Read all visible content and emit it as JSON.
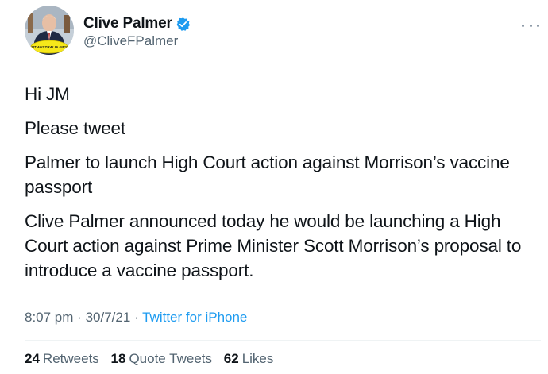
{
  "author": {
    "display_name": "Clive Palmer",
    "handle": "@CliveFPalmer",
    "avatar_badge_text": "PUT AUSTRALIA FIRST",
    "verified_icon": "verified-badge-icon"
  },
  "tweet": {
    "paragraphs": [
      "Hi JM",
      "Please tweet",
      "Palmer to launch High Court action against Morrison’s vaccine passport",
      "Clive Palmer announced today he would be launching a High Court action against Prime Minister Scott Morrison’s proposal to introduce a vaccine passport."
    ],
    "time": "8:07 pm",
    "date": "30/7/21",
    "separator": "·",
    "source": "Twitter for iPhone"
  },
  "stats": {
    "retweets_count": "24",
    "retweets_label": "Retweets",
    "quote_count": "18",
    "quote_label": "Quote Tweets",
    "likes_count": "62",
    "likes_label": "Likes"
  },
  "colors": {
    "text": "#0f1419",
    "secondary": "#536471",
    "accent": "#1d9bf0",
    "badge_yellow": "#f6e81a"
  }
}
